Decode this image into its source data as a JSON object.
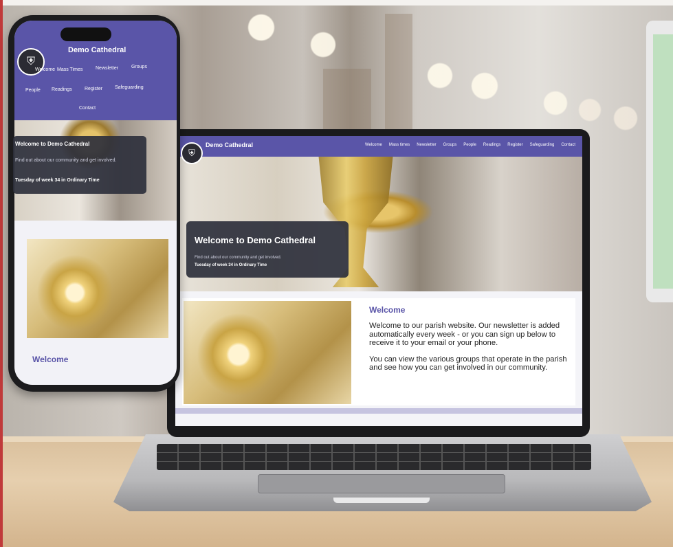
{
  "site": {
    "title": "Demo Cathedral",
    "logo_icon": "shield-crest-icon",
    "brand_color": "#5a55a8"
  },
  "laptop": {
    "nav": [
      "Welcome",
      "Mass times",
      "Newsletter",
      "Groups",
      "People",
      "Readings",
      "Register",
      "Safeguarding",
      "Contact"
    ],
    "hero": {
      "card_title": "Welcome to Demo Cathedral",
      "card_subtitle": "Find out about our community and get involved.",
      "liturgical_day": "Tuesday of week 34 in Ordinary Time"
    },
    "content": {
      "heading": "Welcome",
      "paragraph_1": "Welcome to our parish website. Our newsletter is added automatically every week - or you can sign up below to receive it to your email or your phone.",
      "paragraph_2": "You can view the various groups that operate in the parish and see how you can get involved in our community."
    }
  },
  "phone": {
    "nav": [
      "Welcome",
      "Mass Times",
      "Newsletter",
      "Groups",
      "People",
      "Readings",
      "Register",
      "Safeguarding",
      "Contact"
    ],
    "hero": {
      "card_title": "Welcome to Demo Cathedral",
      "card_subtitle": "Find out about our community and get involved.",
      "liturgical_day": "Tuesday of week 34 in Ordinary Time"
    },
    "content": {
      "heading": "Welcome"
    }
  }
}
